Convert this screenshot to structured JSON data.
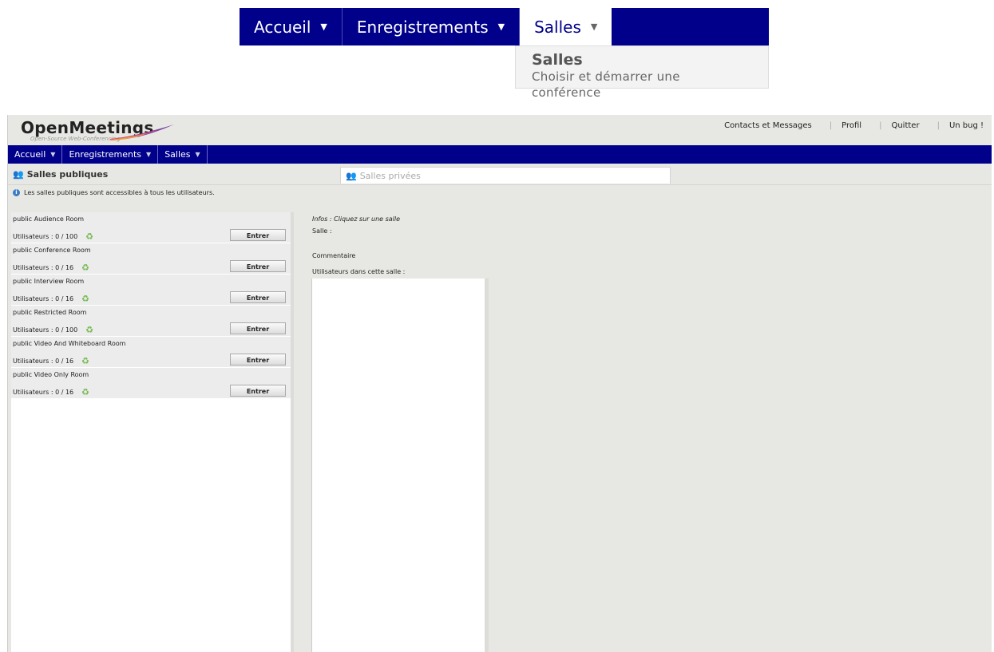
{
  "zoom_menu": {
    "items": [
      {
        "label": "Accueil"
      },
      {
        "label": "Enregistrements"
      },
      {
        "label": "Salles"
      }
    ],
    "dropdown": {
      "title": "Salles",
      "subtitle": "Choisir et démarrer une conférence"
    }
  },
  "header": {
    "logo_text": "OpenMeetings",
    "logo_sub": "Open-Source Web-Conferencing",
    "links": [
      "Contacts et Messages",
      "Profil",
      "Quitter",
      "Un bug !"
    ]
  },
  "nav": {
    "items": [
      {
        "label": "Accueil"
      },
      {
        "label": "Enregistrements"
      },
      {
        "label": "Salles"
      }
    ]
  },
  "tabs": {
    "public": "Salles publiques",
    "private": "Salles privées"
  },
  "info_line": "Les salles publiques sont accessibles à tous les utilisateurs.",
  "rooms": [
    {
      "name": "public Audience Room",
      "users": "Utilisateurs : 0 / 100",
      "button": "Entrer"
    },
    {
      "name": "public Conference Room",
      "users": "Utilisateurs : 0 / 16",
      "button": "Entrer"
    },
    {
      "name": "public Interview Room",
      "users": "Utilisateurs : 0 / 16",
      "button": "Entrer"
    },
    {
      "name": "public Restricted Room",
      "users": "Utilisateurs : 0 / 100",
      "button": "Entrer"
    },
    {
      "name": "public Video And Whiteboard Room",
      "users": "Utilisateurs : 0 / 16",
      "button": "Entrer"
    },
    {
      "name": "public Video Only Room",
      "users": "Utilisateurs : 0 / 16",
      "button": "Entrer"
    }
  ],
  "info_panel": {
    "title": "Infos : Cliquez sur une salle",
    "room_label": "Salle :",
    "comment_label": "Commentaire",
    "users_label": "Utilisateurs dans cette salle :"
  },
  "colors": {
    "nav_bg": "#00008b",
    "panel_bg": "#e7e7e3",
    "refresh_icon": "#6fb84a"
  }
}
